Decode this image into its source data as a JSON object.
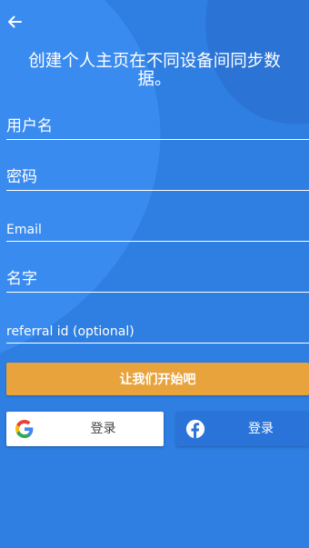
{
  "colors": {
    "background": "#2f7fe2",
    "start_button": "#e8a33d",
    "facebook_button": "#2a73d9",
    "google_button": "#ffffff",
    "text": "#ffffff"
  },
  "header": {
    "back_icon": "arrow-left-icon",
    "headline_line1": "创建个人主页在不同设备间同步数",
    "headline_line2": "据。"
  },
  "form": {
    "username_placeholder": "用户名",
    "password_placeholder": "密码",
    "email_placeholder": "Email",
    "name_placeholder": "名字",
    "referral_placeholder": "referral id (optional)"
  },
  "actions": {
    "start_label": "让我们开始吧",
    "google_label": "登录",
    "google_icon": "google-icon",
    "facebook_label": "登录",
    "facebook_icon": "facebook-icon"
  }
}
